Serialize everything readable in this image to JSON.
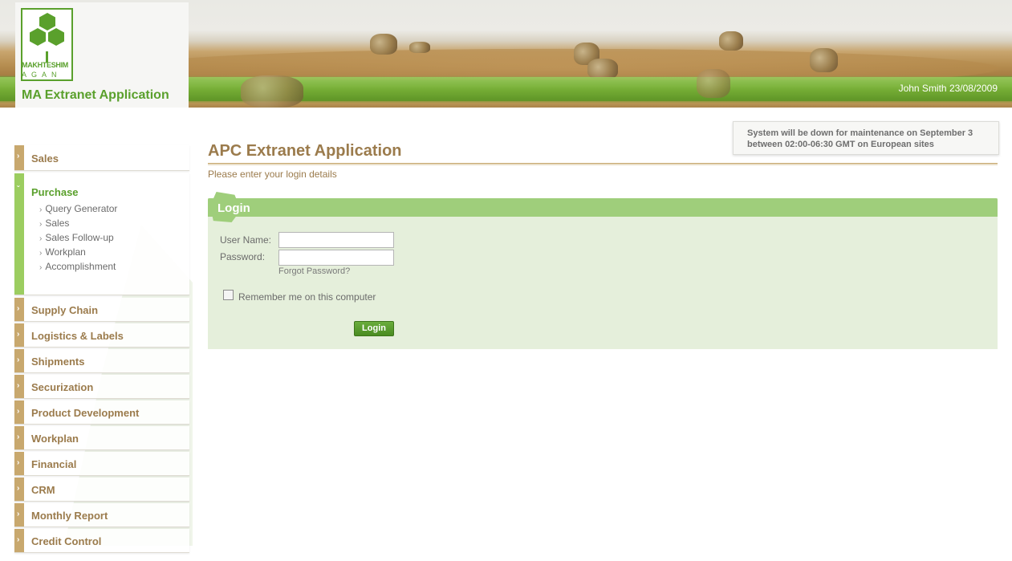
{
  "header": {
    "logo_line1": "MAKHTESHIM",
    "logo_line2": "AGAN",
    "app_title": "MA Extranet Application",
    "user_info": "John Smith 23/08/2009"
  },
  "sidebar": {
    "items": [
      {
        "label": "Sales"
      },
      {
        "label": "Purchase",
        "expanded": true,
        "children": [
          "Query Generator",
          "Sales",
          "Sales Follow-up",
          "Workplan",
          "Accomplishment"
        ]
      },
      {
        "label": "Supply Chain"
      },
      {
        "label": "Logistics & Labels"
      },
      {
        "label": "Shipments"
      },
      {
        "label": "Securization"
      },
      {
        "label": "Product Development"
      },
      {
        "label": "Workplan"
      },
      {
        "label": "Financial"
      },
      {
        "label": "CRM"
      },
      {
        "label": "Monthly Report"
      },
      {
        "label": "Credit Control"
      }
    ]
  },
  "notice": {
    "line1": "System will be down for maintenance on September 3",
    "line2": "between 02:00-06:30 GMT on European sites"
  },
  "main": {
    "title": "APC Extranet Application",
    "subtitle": "Please enter your login details"
  },
  "login": {
    "title": "Login",
    "username_label": "User Name:",
    "username_value": "",
    "password_label": "Password:",
    "password_value": "",
    "forgot_label": "Forgot Password?",
    "remember_label": "Remember me on this computer",
    "remember_checked": false,
    "button_label": "Login"
  },
  "colors": {
    "brand_green": "#5aa02c",
    "accent_tan": "#9b7b4c",
    "panel_bg": "#e5efdb",
    "panel_header": "#9fce7b"
  },
  "icons": {
    "collapsed_arrow": "chevron-right-icon",
    "expanded_arrow": "chevron-down-icon",
    "logo": "hexagon-cluster-logo"
  }
}
